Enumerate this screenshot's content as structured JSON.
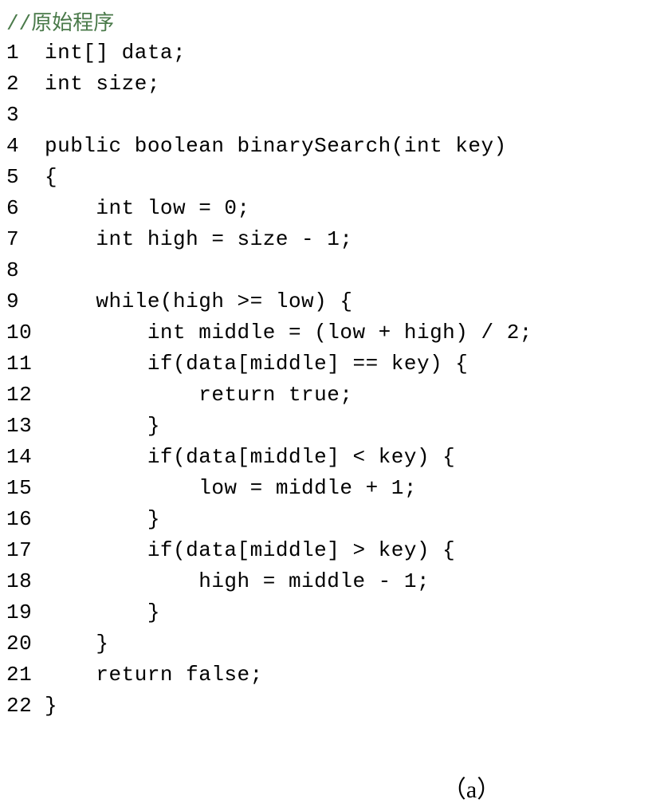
{
  "comment": "//原始程序",
  "lines": [
    {
      "num": "1",
      "code": "int[] data;"
    },
    {
      "num": "2",
      "code": "int size;"
    },
    {
      "num": "3",
      "code": ""
    },
    {
      "num": "4",
      "code": "public boolean binarySearch(int key)"
    },
    {
      "num": "5",
      "code": "{"
    },
    {
      "num": "6",
      "code": "    int low = 0;"
    },
    {
      "num": "7",
      "code": "    int high = size - 1;"
    },
    {
      "num": "8",
      "code": ""
    },
    {
      "num": "9",
      "code": "    while(high >= low) {"
    },
    {
      "num": "10",
      "code": "        int middle = (low + high) / 2;"
    },
    {
      "num": "11",
      "code": "        if(data[middle] == key) {"
    },
    {
      "num": "12",
      "code": "            return true;"
    },
    {
      "num": "13",
      "code": "        }"
    },
    {
      "num": "14",
      "code": "        if(data[middle] < key) {"
    },
    {
      "num": "15",
      "code": "            low = middle + 1;"
    },
    {
      "num": "16",
      "code": "        }"
    },
    {
      "num": "17",
      "code": "        if(data[middle] > key) {"
    },
    {
      "num": "18",
      "code": "            high = middle - 1;"
    },
    {
      "num": "19",
      "code": "        }"
    },
    {
      "num": "20",
      "code": "    }"
    },
    {
      "num": "21",
      "code": "    return false;"
    },
    {
      "num": "22",
      "code": "}"
    }
  ],
  "caption": "（a）"
}
